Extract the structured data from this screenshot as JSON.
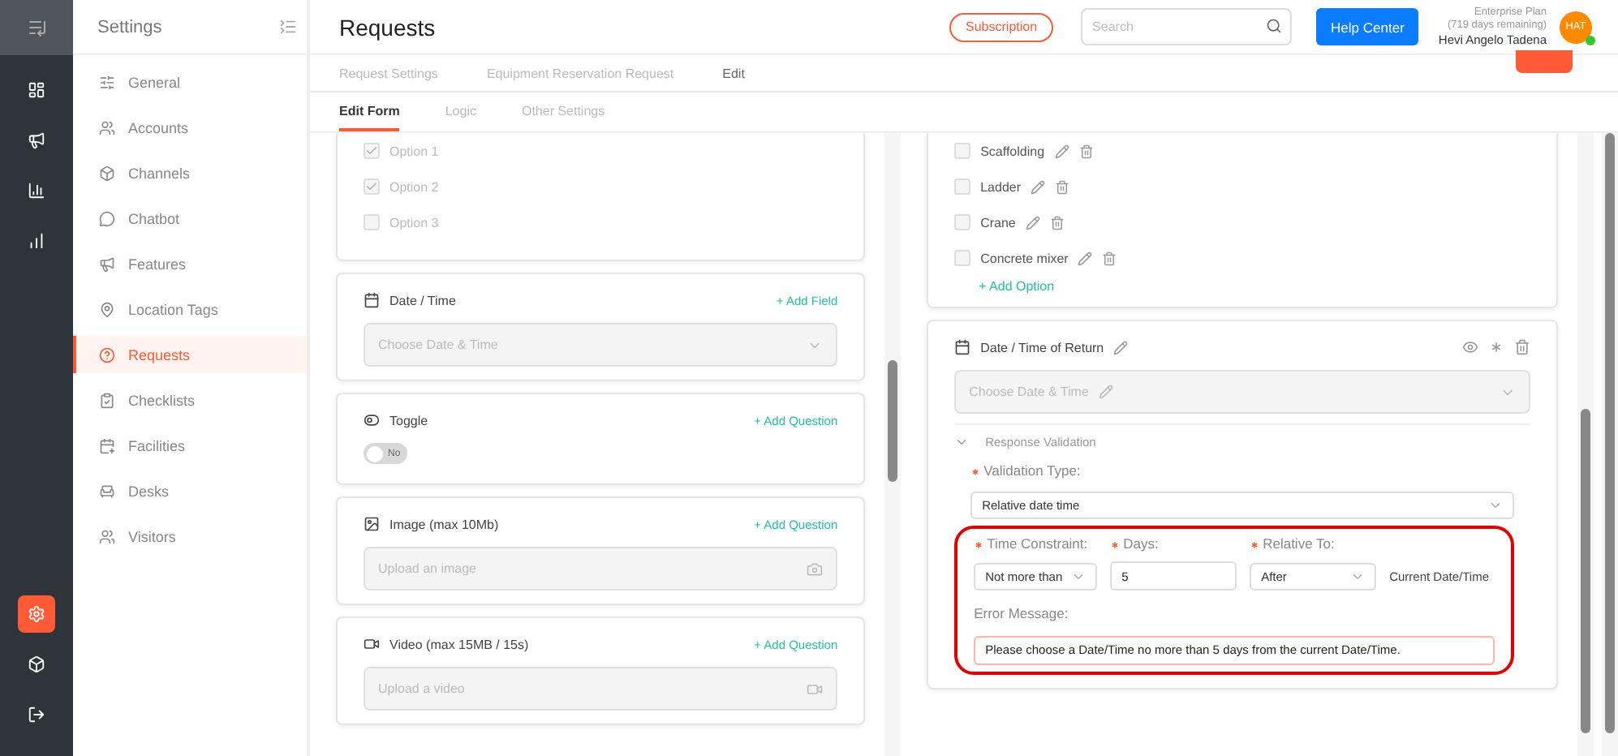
{
  "rail": {
    "items": [
      {
        "selected": false
      },
      {
        "selected": false
      },
      {
        "selected": false
      },
      {
        "selected": false
      }
    ],
    "bottom": [
      {
        "selected": true
      },
      {
        "selected": false
      },
      {
        "selected": false
      }
    ]
  },
  "sidebar": {
    "title": "Settings",
    "items": [
      {
        "label": "General",
        "selected": false
      },
      {
        "label": "Accounts",
        "selected": false
      },
      {
        "label": "Channels",
        "selected": false
      },
      {
        "label": "Chatbot",
        "selected": false
      },
      {
        "label": "Features",
        "selected": false
      },
      {
        "label": "Location Tags",
        "selected": false
      },
      {
        "label": "Requests",
        "selected": true
      },
      {
        "label": "Checklists",
        "selected": false
      },
      {
        "label": "Facilities",
        "selected": false
      },
      {
        "label": "Desks",
        "selected": false
      },
      {
        "label": "Visitors",
        "selected": false
      }
    ]
  },
  "header": {
    "title": "Requests",
    "subscription": "Subscription",
    "search": {
      "placeholder": "Search"
    },
    "help": "Help Center",
    "plan": "Enterprise Plan",
    "remaining": "(719 days remaining)",
    "user": "Hevi Angelo Tadena",
    "avatar": "HAT",
    "online": true
  },
  "breadcrumb": [
    "Request Settings",
    "Equipment Reservation Request",
    "Edit"
  ],
  "tabs": [
    {
      "label": "Edit Form",
      "selected": true
    },
    {
      "label": "Logic",
      "selected": false
    },
    {
      "label": "Other Settings",
      "selected": false
    }
  ],
  "left_cards": [
    {
      "kind": "checkbox",
      "options": [
        {
          "label": "Option 1",
          "checked": true
        },
        {
          "label": "Option 2",
          "checked": true
        },
        {
          "label": "Option 3",
          "checked": false
        }
      ]
    },
    {
      "kind": "date",
      "title": "Date / Time",
      "action": "+ Add Field",
      "placeholder": "Choose Date & Time"
    },
    {
      "kind": "toggle",
      "title": "Toggle",
      "action": "+ Add Question",
      "toggle": {
        "label": "No",
        "on": false
      }
    },
    {
      "kind": "image",
      "title": "Image (max 10Mb)",
      "action": "+ Add Question",
      "placeholder": "Upload an image"
    },
    {
      "kind": "video",
      "title": "Video (max 15MB / 15s)",
      "action": "+ Add Question",
      "placeholder": "Upload a video"
    }
  ],
  "right_cards": {
    "options_card": {
      "options": [
        {
          "label": "Scaffolding",
          "checked": false
        },
        {
          "label": "Ladder",
          "checked": false
        },
        {
          "label": "Crane",
          "checked": false
        },
        {
          "label": "Concrete mixer",
          "checked": false
        }
      ],
      "add_option": "+ Add Option"
    },
    "date_card": {
      "title": "Date / Time of Return",
      "placeholder": "Choose Date & Time",
      "validation": {
        "label": "Response Validation",
        "expanded": true,
        "validation_type": {
          "label": "Validation Type:",
          "required": true,
          "value": "Relative date time"
        },
        "time_constraint": {
          "label": "Time Constraint:",
          "required": true,
          "value": "Not more than"
        },
        "days": {
          "label": "Days:",
          "required": true,
          "value": "5"
        },
        "relative_to": {
          "label": "Relative To:",
          "required": true,
          "value": "After"
        },
        "suffix": "Current Date/Time",
        "error_message": {
          "label": "Error Message:",
          "value": "Please choose a Date/Time no more than 5 days from the current Date/Time."
        },
        "highlighted": true
      }
    }
  }
}
